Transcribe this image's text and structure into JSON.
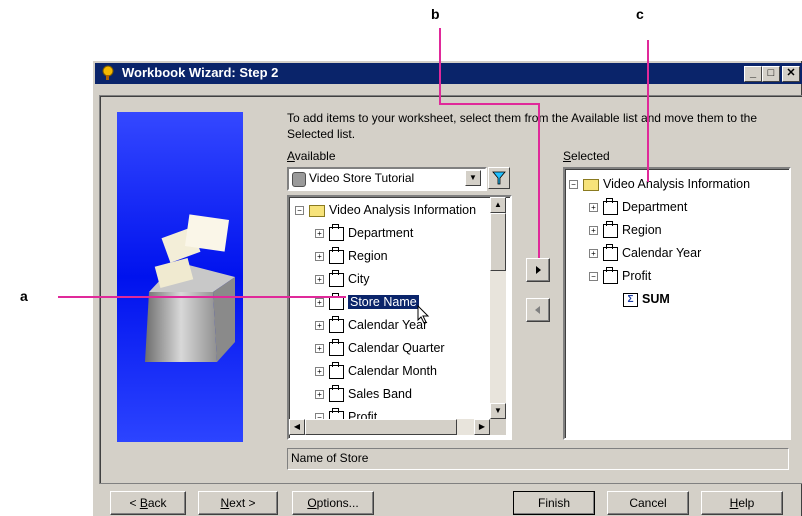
{
  "window": {
    "title": "Workbook Wizard: Step 2",
    "title_buttons": [
      "_",
      "□",
      "✕"
    ]
  },
  "instruction": "To add items to your worksheet, select them from the Available list and move them to the Selected list.",
  "available": {
    "label": "Available",
    "business_area": "Video Store Tutorial",
    "root": "Video Analysis Information",
    "items": [
      "Department",
      "Region",
      "City",
      "Store Name",
      "Calendar Year",
      "Calendar Quarter",
      "Calendar Month",
      "Sales Band",
      "Profit"
    ],
    "selected_item": "Store Name"
  },
  "selected": {
    "label": "Selected",
    "root": "Video Analysis Information",
    "items": [
      "Department",
      "Region",
      "Calendar Year",
      "Profit"
    ],
    "profit_child": "SUM"
  },
  "description": "Name of Store",
  "buttons": {
    "back": "< Back",
    "next": "Next >",
    "options": "Options...",
    "finish": "Finish",
    "cancel": "Cancel",
    "help": "Help"
  },
  "callouts": {
    "a": "a",
    "b": "b",
    "c": "c"
  },
  "colors": {
    "titlebar": "#0a246a",
    "callout_line": "#e0299a",
    "selection": "#0a246a"
  }
}
